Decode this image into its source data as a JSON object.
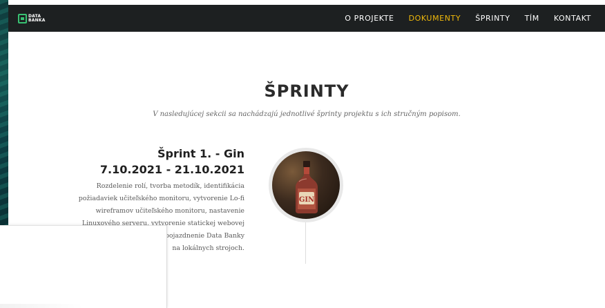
{
  "nav": {
    "logo": {
      "line1": "DATA",
      "line2": "BANKA"
    },
    "links": [
      "O PROJEKTE",
      "DOKUMENTY",
      "ŠPRINTY",
      "TÍM",
      "KONTAKT"
    ],
    "active_index": 1,
    "active_color": "#f0b90b"
  },
  "section": {
    "title": "ŠPRINTY",
    "subtitle": "V nasledujúcej sekcii sa nachádzajú jednotlivé šprinty projektu s ich stručným popisom."
  },
  "sprint": {
    "title": "Šprint 1. - Gin",
    "dates": "7.10.2021 - 21.10.2021",
    "description_lines": [
      "Rozdelenie rolí, tvorba metodík, identifikácia",
      "požiadaviek učiteľského monitoru, vytvorenie Lo-fi",
      "wireframov učiteľského monitoru, nastavenie",
      "Linuxového serveru, vytvorenie statickej webovej",
      "stránky, rozbehnutie a pojazdnenie Data Banky",
      "na lokálnych strojoch."
    ],
    "image_label": "GIN"
  }
}
